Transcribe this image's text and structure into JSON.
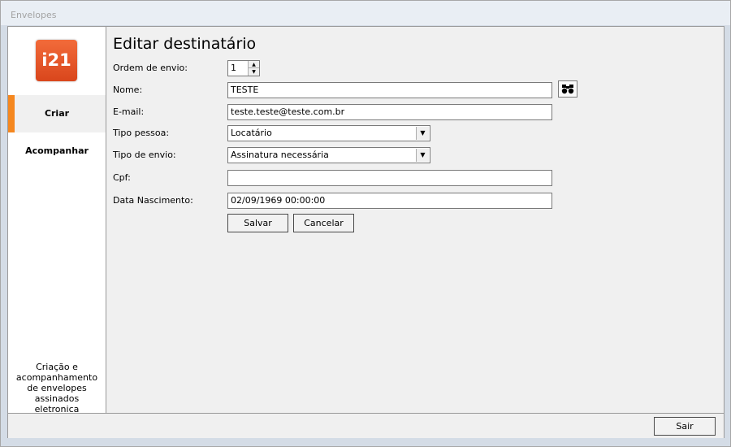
{
  "window": {
    "title": "Envelopes"
  },
  "sidebar": {
    "logo_text": "i21",
    "items": [
      {
        "label": "Criar",
        "selected": true
      },
      {
        "label": "Acompanhar",
        "selected": false
      }
    ],
    "description": "Criação e acompanhamento de envelopes assinados eletronica"
  },
  "form": {
    "title": "Editar destinatário",
    "fields": {
      "ordem": {
        "label": "Ordem de envio:",
        "value": "1"
      },
      "nome": {
        "label": "Nome:",
        "value": "TESTE"
      },
      "email": {
        "label": "E-mail:",
        "value": "teste.teste@teste.com.br"
      },
      "tipo_pessoa": {
        "label": "Tipo pessoa:",
        "value": "Locatário"
      },
      "tipo_envio": {
        "label": "Tipo de envio:",
        "value": "Assinatura necessária"
      },
      "cpf": {
        "label": "Cpf:",
        "value": ""
      },
      "data_nascimento": {
        "label": "Data Nascimento:",
        "value": "02/09/1969 00:00:00"
      }
    },
    "buttons": {
      "save": "Salvar",
      "cancel": "Cancelar"
    }
  },
  "footer": {
    "exit": "Sair"
  },
  "icons": {
    "search": "binoculars-icon",
    "dropdown": "chevron-down-icon",
    "spin_up": "arrow-up-icon",
    "spin_down": "arrow-down-icon"
  },
  "colors": {
    "accent": "#f5871f",
    "logo": "#e8562a",
    "background": "#f0f0f0"
  }
}
